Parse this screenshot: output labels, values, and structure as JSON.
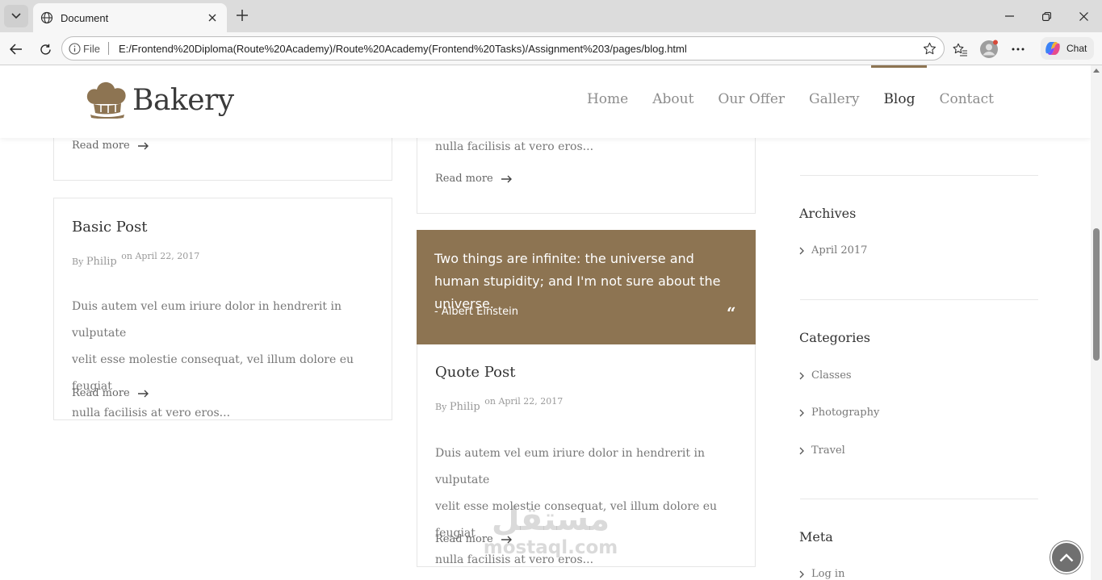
{
  "browser": {
    "tab_title": "Document",
    "file_label": "File",
    "url": "E:/Frontend%20Diploma(Route%20Academy)/Route%20Academy(Frontend%20Tasks)/Assignment%203/pages/blog.html",
    "chat_label": "Chat"
  },
  "site": {
    "brand": "Bakery",
    "nav": [
      "Home",
      "About",
      "Our Offer",
      "Gallery",
      "Blog",
      "Contact"
    ],
    "active_nav": "Blog",
    "accent_color": "#8d7452"
  },
  "posts": {
    "left_top": {
      "read_more": "Read more"
    },
    "middle_top": {
      "excerpt_tail": "nulla facilisis at vero eros...",
      "read_more": "Read more"
    },
    "basic": {
      "title": "Basic Post",
      "by": "By",
      "author": "Philip",
      "date": "on April 22, 2017",
      "excerpt_lines": [
        "Duis autem vel eum iriure dolor in hendrerit in vulputate",
        "velit esse molestie consequat, vel illum dolore eu feugiat",
        "nulla facilisis at vero eros..."
      ],
      "read_more": "Read more"
    },
    "quote": {
      "quote_text": "Two things are infinite: the universe and human stupidity; and I'm not sure about the universe.",
      "quote_author": "- Albert Einstein",
      "quote_icon": "quote-icon",
      "title": "Quote Post",
      "by": "By",
      "author": "Philip",
      "date": "on April 22, 2017",
      "excerpt_lines": [
        "Duis autem vel eum iriure dolor in hendrerit in vulputate",
        "velit esse molestie consequat, vel illum dolore eu feugiat",
        "nulla facilisis at vero eros..."
      ],
      "read_more": "Read more"
    }
  },
  "sidebar": {
    "archives": {
      "heading": "Archives",
      "items": [
        "April 2017"
      ]
    },
    "categories": {
      "heading": "Categories",
      "items": [
        "Classes",
        "Photography",
        "Travel"
      ]
    },
    "meta": {
      "heading": "Meta",
      "items": [
        "Log in"
      ]
    }
  },
  "watermark": {
    "arabic": "مستقل",
    "latin": "mostaql.com"
  }
}
